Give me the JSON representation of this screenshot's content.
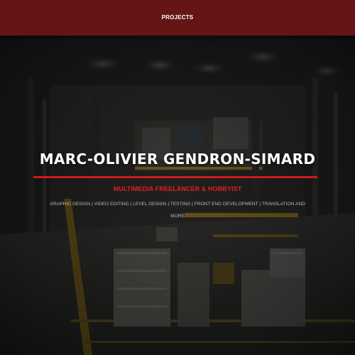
{
  "nav": {
    "projects_label": "PROJECTS"
  },
  "hero": {
    "title": "MARC-OLIVIER GENDRON-SIMARD",
    "subtitle": "MULTIMEDIA FREELANCER & HOBBYIST",
    "skills": "GRAPHIC DESIGN | VIDEO EDITING | LEVEL DESIGN | TESTING | FRONT END DEVELOPMENT | TRANSLATION AND MORE"
  },
  "colors": {
    "navbar_bg": "#651515",
    "accent_red": "#cf1a1a",
    "subtitle_red": "#e0201f",
    "title_white": "#ffffff",
    "skills_gray": "#b8b8b8"
  },
  "background": {
    "icon": "warehouse-scene-image"
  }
}
